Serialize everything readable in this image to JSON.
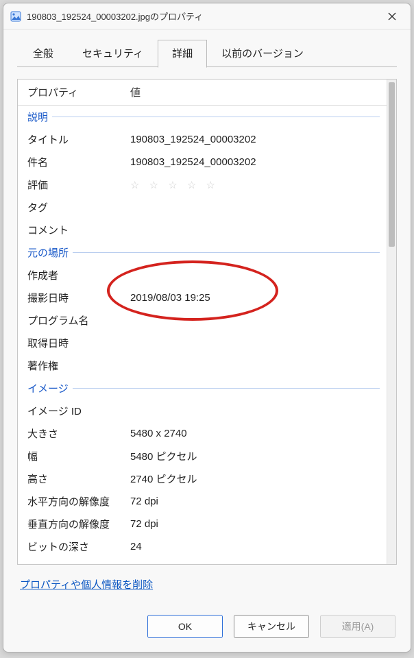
{
  "window": {
    "title": "190803_192524_00003202.jpgのプロパティ"
  },
  "tabs": {
    "general": "全般",
    "security": "セキュリティ",
    "details": "詳細",
    "previous": "以前のバージョン"
  },
  "columns": {
    "property": "プロパティ",
    "value": "値"
  },
  "sections": {
    "description": "説明",
    "origin": "元の場所",
    "image": "イメージ"
  },
  "rows": {
    "title_k": "タイトル",
    "title_v": "190803_192524_00003202",
    "subject_k": "件名",
    "subject_v": "190803_192524_00003202",
    "rating_k": "評価",
    "tags_k": "タグ",
    "tags_v": "",
    "comment_k": "コメント",
    "comment_v": "",
    "author_k": "作成者",
    "author_v": "",
    "taken_k": "撮影日時",
    "taken_v": "2019/08/03 19:25",
    "program_k": "プログラム名",
    "program_v": "",
    "acq_k": "取得日時",
    "acq_v": "",
    "copyright_k": "著作権",
    "copyright_v": "",
    "imageid_k": "イメージ ID",
    "imageid_v": "",
    "dim_k": "大きさ",
    "dim_v": "5480 x 2740",
    "width_k": "幅",
    "width_v": "5480 ピクセル",
    "height_k": "高さ",
    "height_v": "2740 ピクセル",
    "hres_k": "水平方向の解像度",
    "hres_v": "72 dpi",
    "vres_k": "垂直方向の解像度",
    "vres_v": "72 dpi",
    "bit_k": "ビットの深さ",
    "bit_v": "24"
  },
  "link": "プロパティや個人情報を削除",
  "buttons": {
    "ok": "OK",
    "cancel": "キャンセル",
    "apply": "適用(A)"
  },
  "stars": "☆ ☆ ☆ ☆ ☆"
}
